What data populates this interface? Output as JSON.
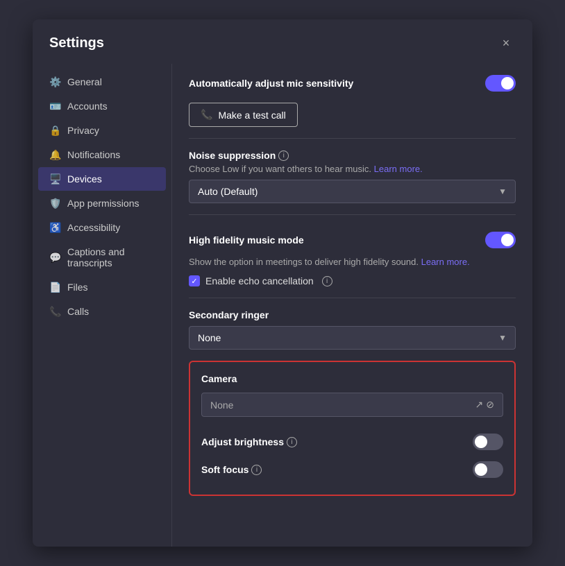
{
  "dialog": {
    "title": "Settings",
    "close_label": "×"
  },
  "sidebar": {
    "items": [
      {
        "id": "general",
        "label": "General",
        "icon": "gear"
      },
      {
        "id": "accounts",
        "label": "Accounts",
        "icon": "person-card"
      },
      {
        "id": "privacy",
        "label": "Privacy",
        "icon": "lock"
      },
      {
        "id": "notifications",
        "label": "Notifications",
        "icon": "bell"
      },
      {
        "id": "devices",
        "label": "Devices",
        "icon": "monitor",
        "active": true
      },
      {
        "id": "app-permissions",
        "label": "App permissions",
        "icon": "shield"
      },
      {
        "id": "accessibility",
        "label": "Accessibility",
        "icon": "accessibility"
      },
      {
        "id": "captions",
        "label": "Captions and transcripts",
        "icon": "caption"
      },
      {
        "id": "files",
        "label": "Files",
        "icon": "file"
      },
      {
        "id": "calls",
        "label": "Calls",
        "icon": "phone"
      }
    ]
  },
  "main": {
    "auto_mic": {
      "label": "Automatically adjust mic sensitivity",
      "toggle_on": true
    },
    "test_call": {
      "label": "Make a test call",
      "icon": "phone"
    },
    "noise_suppression": {
      "label": "Noise suppression",
      "sublabel": "Choose Low if you want others to hear music.",
      "learn_more": "Learn more.",
      "dropdown_value": "Auto (Default)"
    },
    "high_fidelity": {
      "label": "High fidelity music mode",
      "toggle_on": true,
      "sublabel": "Show the option in meetings to deliver high fidelity sound.",
      "learn_more": "Learn more."
    },
    "echo_cancellation": {
      "label": "Enable echo cancellation",
      "checked": true
    },
    "secondary_ringer": {
      "label": "Secondary ringer",
      "dropdown_value": "None"
    },
    "camera": {
      "label": "Camera",
      "dropdown_value": "None",
      "adjust_brightness": {
        "label": "Adjust brightness",
        "toggle_on": false
      },
      "soft_focus": {
        "label": "Soft focus",
        "toggle_on": false
      }
    }
  },
  "icons": {
    "gear": "⚙",
    "person_card": "▤",
    "lock": "🔒",
    "bell": "🔔",
    "monitor": "🖥",
    "shield": "🛡",
    "accessibility": "♿",
    "caption": "▭",
    "file": "📄",
    "phone": "📞"
  }
}
